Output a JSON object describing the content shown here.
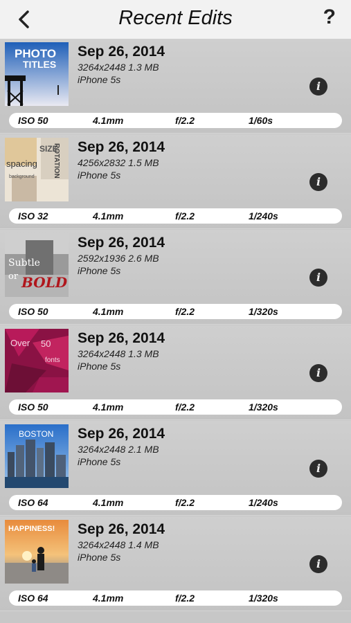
{
  "nav": {
    "title": "Recent Edits",
    "help_label": "?"
  },
  "rows": [
    {
      "date": "Sep 26, 2014",
      "dims": "3264x2448 1.3 MB",
      "device": "iPhone 5s",
      "info_label": "i",
      "iso": "ISO 50",
      "focal": "4.1mm",
      "aperture": "f/2.2",
      "shutter": "1/60s",
      "thumb_text": [
        "PHOTO",
        "TITLES"
      ]
    },
    {
      "date": "Sep 26, 2014",
      "dims": "4256x2832 1.5 MB",
      "device": "iPhone 5s",
      "info_label": "i",
      "iso": "ISO 32",
      "focal": "4.1mm",
      "aperture": "f/2.2",
      "shutter": "1/240s",
      "thumb_text": [
        "spacing",
        "SIZE",
        "ROTATION",
        "background"
      ]
    },
    {
      "date": "Sep 26, 2014",
      "dims": "2592x1936 2.6 MB",
      "device": "iPhone 5s",
      "info_label": "i",
      "iso": "ISO 50",
      "focal": "4.1mm",
      "aperture": "f/2.2",
      "shutter": "1/320s",
      "thumb_text": [
        "Subtle",
        "or",
        "BOLD"
      ]
    },
    {
      "date": "Sep 26, 2014",
      "dims": "3264x2448 1.3 MB",
      "device": "iPhone 5s",
      "info_label": "i",
      "iso": "ISO 50",
      "focal": "4.1mm",
      "aperture": "f/2.2",
      "shutter": "1/320s",
      "thumb_text": [
        "Over",
        "50",
        "fonts"
      ]
    },
    {
      "date": "Sep 26, 2014",
      "dims": "3264x2448 2.1 MB",
      "device": "iPhone 5s",
      "info_label": "i",
      "iso": "ISO 64",
      "focal": "4.1mm",
      "aperture": "f/2.2",
      "shutter": "1/240s",
      "thumb_text": [
        "BOSTON"
      ]
    },
    {
      "date": "Sep 26, 2014",
      "dims": "3264x2448 1.4 MB",
      "device": "iPhone 5s",
      "info_label": "i",
      "iso": "ISO 64",
      "focal": "4.1mm",
      "aperture": "f/2.2",
      "shutter": "1/320s",
      "thumb_text": [
        "HAPPINESS!"
      ]
    }
  ]
}
